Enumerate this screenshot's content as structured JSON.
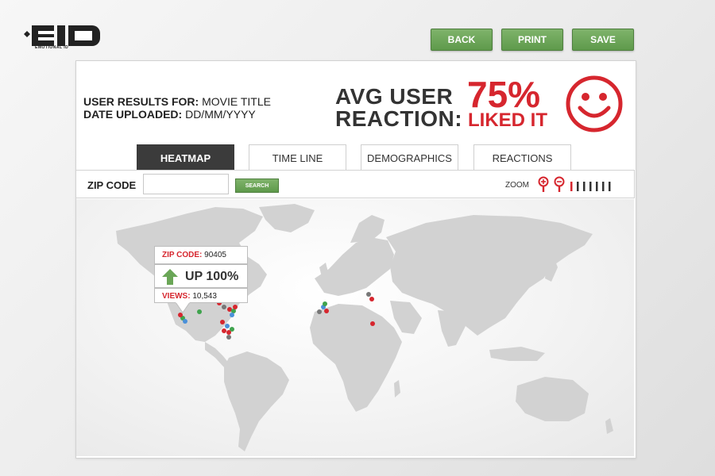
{
  "logo": {
    "text": "EID",
    "subtitle": "EMOTIONAL ID"
  },
  "toolbar_top": {
    "back": "BACK",
    "print": "PRINT",
    "save": "SAVE"
  },
  "user_results": {
    "label": "USER RESULTS FOR:",
    "title": "MOVIE TITLE",
    "date_label": "DATE UPLOADED:",
    "date": "DD/MM/YYYY"
  },
  "reaction": {
    "line1": "AVG USER",
    "line2": "REACTION:",
    "percent": "75%",
    "verdict": "LIKED IT",
    "icon": "smiley-face-icon"
  },
  "tabs": [
    {
      "label": "HEATMAP",
      "active": true
    },
    {
      "label": "TIME LINE",
      "active": false
    },
    {
      "label": "DEMOGRAPHICS",
      "active": false
    },
    {
      "label": "REACTIONS",
      "active": false
    }
  ],
  "search": {
    "label": "ZIP CODE",
    "value": "",
    "placeholder": "",
    "button": "SEARCH"
  },
  "zoom": {
    "label": "ZOOM",
    "icons": [
      "zoom-in-icon",
      "zoom-out-icon"
    ]
  },
  "tooltip": {
    "zip_label": "ZIP CODE:",
    "zip_value": "90405",
    "trend_icon": "arrow-up-icon",
    "trend": "UP 100%",
    "views_label": "VIEWS:",
    "views_value": "10,543"
  },
  "colors": {
    "accent_red": "#d6262e",
    "button_green": "#6aa657",
    "tab_active": "#3b3b3b",
    "land": "#d2d2d2",
    "dot_blue": "#4a90d9",
    "dot_green": "#3fa34d",
    "dot_gray": "#777777"
  }
}
